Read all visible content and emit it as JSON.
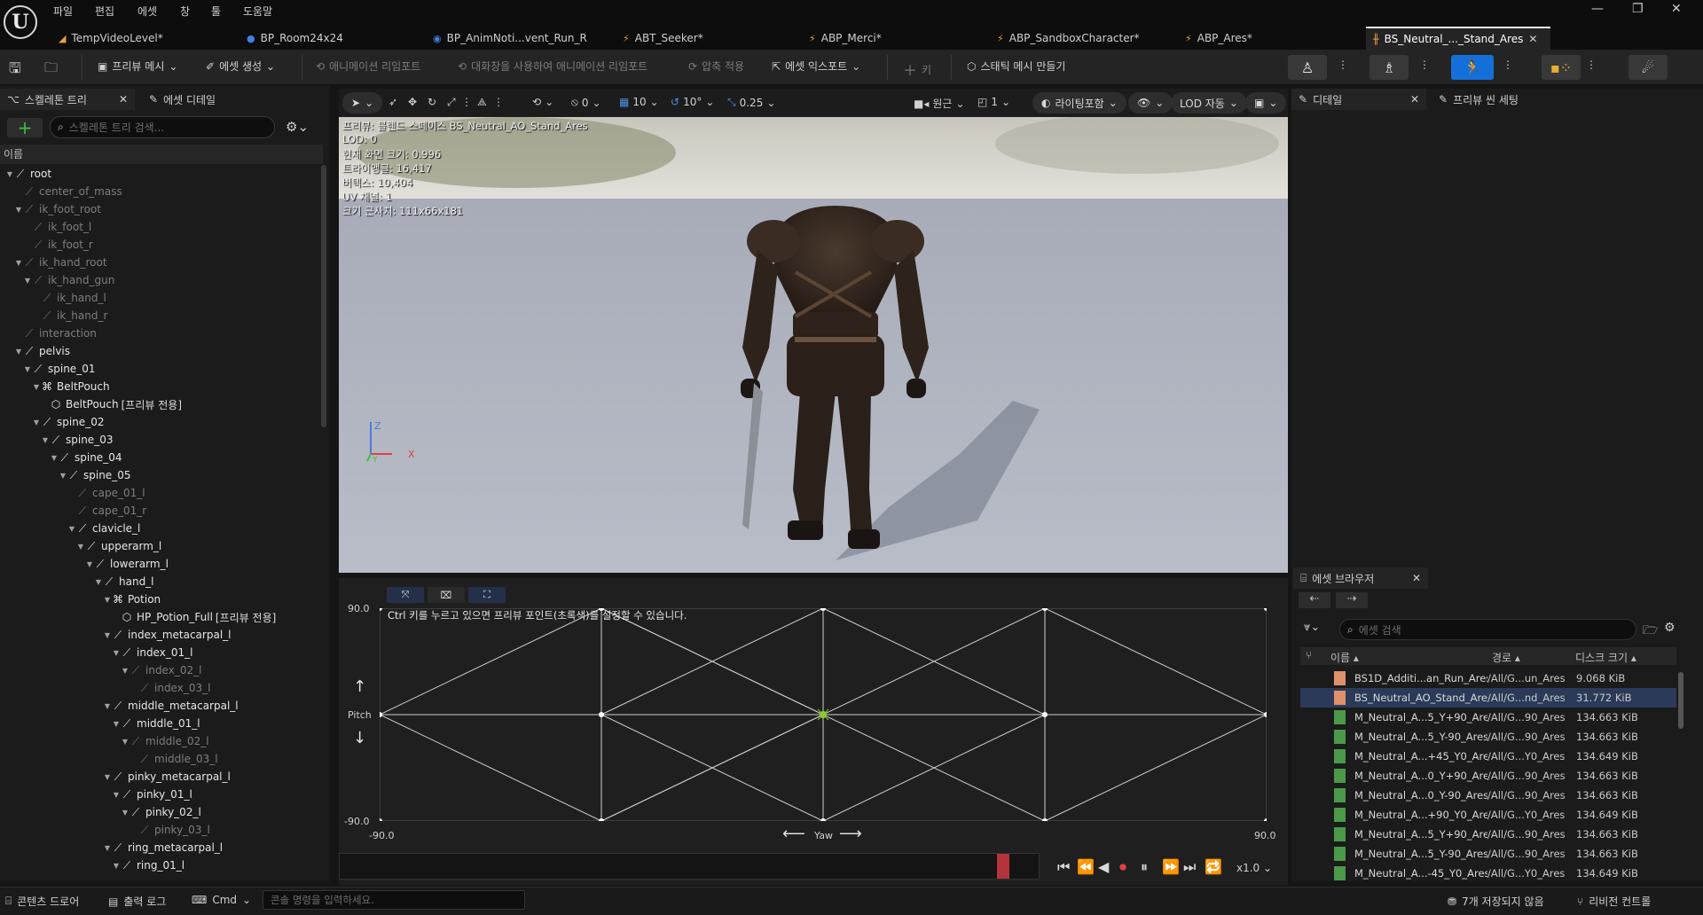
{
  "menu": [
    "파일",
    "편집",
    "에셋",
    "창",
    "툴",
    "도움말"
  ],
  "tabs": [
    {
      "label": "TempVideoLevel*",
      "icon": "level-icon"
    },
    {
      "label": "BP_Room24x24",
      "icon": "blueprint-icon"
    },
    {
      "label": "BP_AnimNoti...vent_Run_R",
      "icon": "blueprint-icon"
    },
    {
      "label": "ABT_Seeker*",
      "icon": "anim-icon"
    },
    {
      "label": "ABP_Merci*",
      "icon": "anim-icon"
    },
    {
      "label": "ABP_SandboxCharacter*",
      "icon": "anim-icon"
    },
    {
      "label": "ABP_Ares*",
      "icon": "anim-icon"
    },
    {
      "label": "BS_Neutral_..._Stand_Ares",
      "icon": "blendspace-icon",
      "active": true
    }
  ],
  "toolbar": {
    "preview_mesh": "프리뷰 메시",
    "create_asset": "에셋 생성",
    "reimport_anim": "애니메이션 리임포트",
    "reimport_dialog": "대화창을 사용하여 애니메이션 리임포트",
    "apply_compression": "압축 적용",
    "export_asset": "에셋 익스포트",
    "key": "키",
    "make_static_mesh": "스태틱 메시 만들기"
  },
  "left_panel": {
    "tab_skeleton": "스켈레톤 트리",
    "tab_asset_details": "에셋 디테일",
    "search_placeholder": "스켈레톤 트리 검색...",
    "column_name": "이름",
    "bones": [
      {
        "name": "root",
        "depth": 0,
        "expand": true,
        "dim": false
      },
      {
        "name": "center_of_mass",
        "depth": 1,
        "expand": false,
        "dim": true
      },
      {
        "name": "ik_foot_root",
        "depth": 1,
        "expand": true,
        "dim": true
      },
      {
        "name": "ik_foot_l",
        "depth": 2,
        "expand": false,
        "dim": true
      },
      {
        "name": "ik_foot_r",
        "depth": 2,
        "expand": false,
        "dim": true
      },
      {
        "name": "ik_hand_root",
        "depth": 1,
        "expand": true,
        "dim": true
      },
      {
        "name": "ik_hand_gun",
        "depth": 2,
        "expand": true,
        "dim": true
      },
      {
        "name": "ik_hand_l",
        "depth": 3,
        "expand": false,
        "dim": true
      },
      {
        "name": "ik_hand_r",
        "depth": 3,
        "expand": false,
        "dim": true
      },
      {
        "name": "interaction",
        "depth": 1,
        "expand": false,
        "dim": true
      },
      {
        "name": "pelvis",
        "depth": 1,
        "expand": true,
        "dim": false
      },
      {
        "name": "spine_01",
        "depth": 2,
        "expand": true,
        "dim": false
      },
      {
        "name": "BeltPouch",
        "depth": 3,
        "expand": true,
        "dim": false,
        "socket": true
      },
      {
        "name": "BeltPouch",
        "depth": 4,
        "expand": false,
        "dim": false,
        "mesh": true,
        "tag": "[프리뷰 전용]"
      },
      {
        "name": "spine_02",
        "depth": 3,
        "expand": true,
        "dim": false
      },
      {
        "name": "spine_03",
        "depth": 4,
        "expand": true,
        "dim": false
      },
      {
        "name": "spine_04",
        "depth": 5,
        "expand": true,
        "dim": false
      },
      {
        "name": "spine_05",
        "depth": 6,
        "expand": true,
        "dim": false
      },
      {
        "name": "cape_01_l",
        "depth": 7,
        "expand": false,
        "dim": true
      },
      {
        "name": "cape_01_r",
        "depth": 7,
        "expand": false,
        "dim": true
      },
      {
        "name": "clavicle_l",
        "depth": 7,
        "expand": true,
        "dim": false
      },
      {
        "name": "upperarm_l",
        "depth": 8,
        "expand": true,
        "dim": false
      },
      {
        "name": "lowerarm_l",
        "depth": 9,
        "expand": true,
        "dim": false
      },
      {
        "name": "hand_l",
        "depth": 10,
        "expand": true,
        "dim": false
      },
      {
        "name": "Potion",
        "depth": 11,
        "expand": true,
        "dim": false,
        "socket": true
      },
      {
        "name": "HP_Potion_Full",
        "depth": 12,
        "expand": false,
        "dim": false,
        "mesh": true,
        "tag": "[프리뷰 전용]"
      },
      {
        "name": "index_metacarpal_l",
        "depth": 11,
        "expand": true,
        "dim": false
      },
      {
        "name": "index_01_l",
        "depth": 12,
        "expand": true,
        "dim": false
      },
      {
        "name": "index_02_l",
        "depth": 13,
        "expand": true,
        "dim": true
      },
      {
        "name": "index_03_l",
        "depth": 14,
        "expand": false,
        "dim": true
      },
      {
        "name": "middle_metacarpal_l",
        "depth": 11,
        "expand": true,
        "dim": false
      },
      {
        "name": "middle_01_l",
        "depth": 12,
        "expand": true,
        "dim": false
      },
      {
        "name": "middle_02_l",
        "depth": 13,
        "expand": true,
        "dim": true
      },
      {
        "name": "middle_03_l",
        "depth": 14,
        "expand": false,
        "dim": true
      },
      {
        "name": "pinky_metacarpal_l",
        "depth": 11,
        "expand": true,
        "dim": false
      },
      {
        "name": "pinky_01_l",
        "depth": 12,
        "expand": true,
        "dim": false
      },
      {
        "name": "pinky_02_l",
        "depth": 13,
        "expand": true,
        "dim": false
      },
      {
        "name": "pinky_03_l",
        "depth": 14,
        "expand": false,
        "dim": true
      },
      {
        "name": "ring_metacarpal_l",
        "depth": 11,
        "expand": true,
        "dim": false
      },
      {
        "name": "ring_01_l",
        "depth": 12,
        "expand": true,
        "dim": false
      }
    ]
  },
  "viewport_toolbar": {
    "snap_rot": "0",
    "grid": "10",
    "rot": "10°",
    "scale": "0.25",
    "perspective": "원근",
    "view_count": "1",
    "lighting": "라이팅포함",
    "lod": "LOD 자동"
  },
  "viewport_overlay": [
    "프리뷰: 블렌드 스페이스 BS_Neutral_AO_Stand_Ares",
    "LOD: 0",
    "현재 화면 크기: 0.996",
    "트라이앵글: 16,417",
    "버텍스: 10,404",
    "UV 채널: 1",
    "크기 근사치: 111x66x181"
  ],
  "axis_gizmo": {
    "z": "Z",
    "x": "X",
    "y": "Y"
  },
  "blend_space": {
    "hint": "Ctrl 키를 누르고 있으면 프리뷰 포인트(초록색)를 설정할 수 있습니다.",
    "y_axis": "Pitch",
    "x_axis": "Yaw",
    "y_max": "90.0",
    "y_min": "-90.0",
    "x_min": "-90.0",
    "x_max": "90.0",
    "speed": "x1.0"
  },
  "right_panel": {
    "tab_details": "디테일",
    "tab_preview_scene": "프리뷰 씬 세팅"
  },
  "asset_browser": {
    "tab": "에셋 브라우저",
    "search_placeholder": "에셋 검색",
    "columns": {
      "name": "이름",
      "path": "경로",
      "size": "디스크 크기"
    },
    "rows": [
      {
        "name": "BS1D_Additi...an_Run_Ares",
        "path": "/All/G...un_Ares",
        "size": "9.068 KiB",
        "color": "#e0906a",
        "selected": false
      },
      {
        "name": "BS_Neutral_AO_Stand_Ares",
        "path": "/All/G...nd_Ares",
        "size": "31.772 KiB",
        "color": "#e0906a",
        "selected": true
      },
      {
        "name": "M_Neutral_A...5_Y+90_Ares",
        "path": "/All/G...90_Ares",
        "size": "134.663 KiB",
        "color": "#4a9a4a",
        "selected": false
      },
      {
        "name": "M_Neutral_A...5_Y-90_Ares",
        "path": "/All/G...90_Ares",
        "size": "134.663 KiB",
        "color": "#4a9a4a",
        "selected": false
      },
      {
        "name": "M_Neutral_A...+45_Y0_Ares",
        "path": "/All/G...Y0_Ares",
        "size": "134.649 KiB",
        "color": "#4a9a4a",
        "selected": false
      },
      {
        "name": "M_Neutral_A...0_Y+90_Ares",
        "path": "/All/G...90_Ares",
        "size": "134.663 KiB",
        "color": "#4a9a4a",
        "selected": false
      },
      {
        "name": "M_Neutral_A...0_Y-90_Ares",
        "path": "/All/G...90_Ares",
        "size": "134.663 KiB",
        "color": "#4a9a4a",
        "selected": false
      },
      {
        "name": "M_Neutral_A...+90_Y0_Ares",
        "path": "/All/G...Y0_Ares",
        "size": "134.649 KiB",
        "color": "#4a9a4a",
        "selected": false
      },
      {
        "name": "M_Neutral_A...5_Y+90_Ares",
        "path": "/All/G...90_Ares",
        "size": "134.663 KiB",
        "color": "#4a9a4a",
        "selected": false
      },
      {
        "name": "M_Neutral_A...5_Y-90_Ares",
        "path": "/All/G...90_Ares",
        "size": "134.663 KiB",
        "color": "#4a9a4a",
        "selected": false
      },
      {
        "name": "M_Neutral_A...-45_Y0_Ares",
        "path": "/All/G...Y0_Ares",
        "size": "134.649 KiB",
        "color": "#4a9a4a",
        "selected": false
      }
    ]
  },
  "statusbar": {
    "content_drawer": "콘텐츠 드로어",
    "output_log": "출력 로그",
    "cmd": "Cmd",
    "cmd_placeholder": "콘솔 명령을 입력하세요.",
    "unsaved": "7개 저장되지 않음",
    "revision": "리비전 컨트롤"
  }
}
